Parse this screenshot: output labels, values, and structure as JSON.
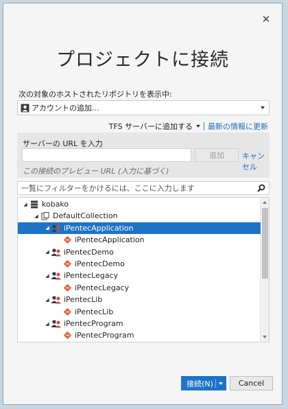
{
  "dialog": {
    "close_label": "✕",
    "title": "プロジェクトに接続"
  },
  "host": {
    "label": "次の対象のホストされたリポジトリを表示中:",
    "selected_value": "アカウントの追加..."
  },
  "links": {
    "tfs_add": "TFS サーバーに追加する",
    "refresh": "最新の情報に更新"
  },
  "server": {
    "label": "サーバーの URL を入力",
    "url_value": "",
    "add_button": "追加",
    "cancel_link": "キャンセル",
    "preview": "この接続のプレビュー URL (入力に基づく)"
  },
  "filter": {
    "placeholder": "一覧にフィルターをかけるには、ここに入力します"
  },
  "tree": {
    "items": [
      {
        "label": "kobako",
        "icon": "server-icon",
        "expanded": true,
        "selected": false
      },
      {
        "label": "DefaultCollection",
        "icon": "collection-icon",
        "expanded": true,
        "selected": false
      },
      {
        "label": "iPentecApplication",
        "icon": "team-project-icon",
        "expanded": true,
        "selected": true
      },
      {
        "label": "iPentecApplication",
        "icon": "git-repo-icon",
        "expanded": false,
        "selected": false
      },
      {
        "label": "iPentecDemo",
        "icon": "team-project-icon",
        "expanded": true,
        "selected": false
      },
      {
        "label": "iPentecDemo",
        "icon": "git-repo-icon",
        "expanded": false,
        "selected": false
      },
      {
        "label": "iPentecLegacy",
        "icon": "team-project-icon",
        "expanded": true,
        "selected": false
      },
      {
        "label": "iPentecLegacy",
        "icon": "git-repo-icon",
        "expanded": false,
        "selected": false
      },
      {
        "label": "iPentecLib",
        "icon": "team-project-icon",
        "expanded": true,
        "selected": false
      },
      {
        "label": "iPentecLib",
        "icon": "git-repo-icon",
        "expanded": false,
        "selected": false
      },
      {
        "label": "iPentecProgram",
        "icon": "team-project-icon",
        "expanded": true,
        "selected": false
      },
      {
        "label": "iPentecProgram",
        "icon": "git-repo-icon",
        "expanded": false,
        "selected": false
      }
    ]
  },
  "buttons": {
    "connect": "接続(N)",
    "cancel": "Cancel"
  },
  "colors": {
    "accent": "#1e73c6",
    "link": "#1b6ec2",
    "git_icon": "#e8623a",
    "team_icon": "#d64141"
  }
}
